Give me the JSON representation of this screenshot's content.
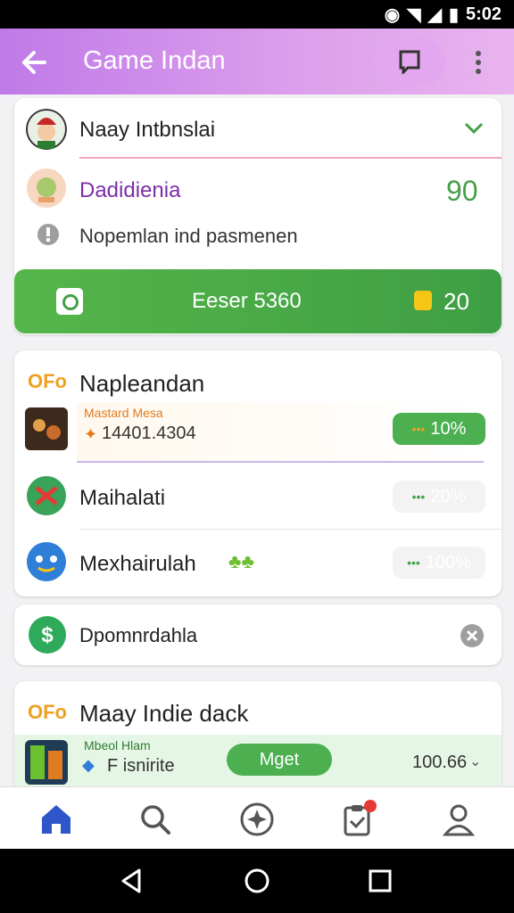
{
  "status_bar": {
    "time": "5:02"
  },
  "app_bar": {
    "title": "Game Indan"
  },
  "card1": {
    "user_name": "Naay Intbnslai",
    "subject_label": "Dadidienia",
    "score": "90",
    "notice_text": "Nopemlan ind  pasmenen",
    "action_label": "Eeser 5360",
    "coin_value": "20"
  },
  "card2": {
    "title": "Napleandan",
    "rows": [
      {
        "sub_label": "Mastard Mesa",
        "value": "14401.4304",
        "percent": "10%"
      },
      {
        "label": "Maihalati",
        "percent": "20%"
      },
      {
        "label": "Mexhairulah",
        "percent": "100%"
      }
    ]
  },
  "card3": {
    "label": "Dpomnrdahla"
  },
  "card4": {
    "title": "Maay Indie dack",
    "sub_label": "Mbeol Hlam",
    "label": "F isnirite",
    "button_label": "Mget",
    "value": "100.66"
  },
  "colors": {
    "accent_green": "#43a047",
    "purple": "#7b2fa6",
    "appbar": "#c07ae8"
  }
}
